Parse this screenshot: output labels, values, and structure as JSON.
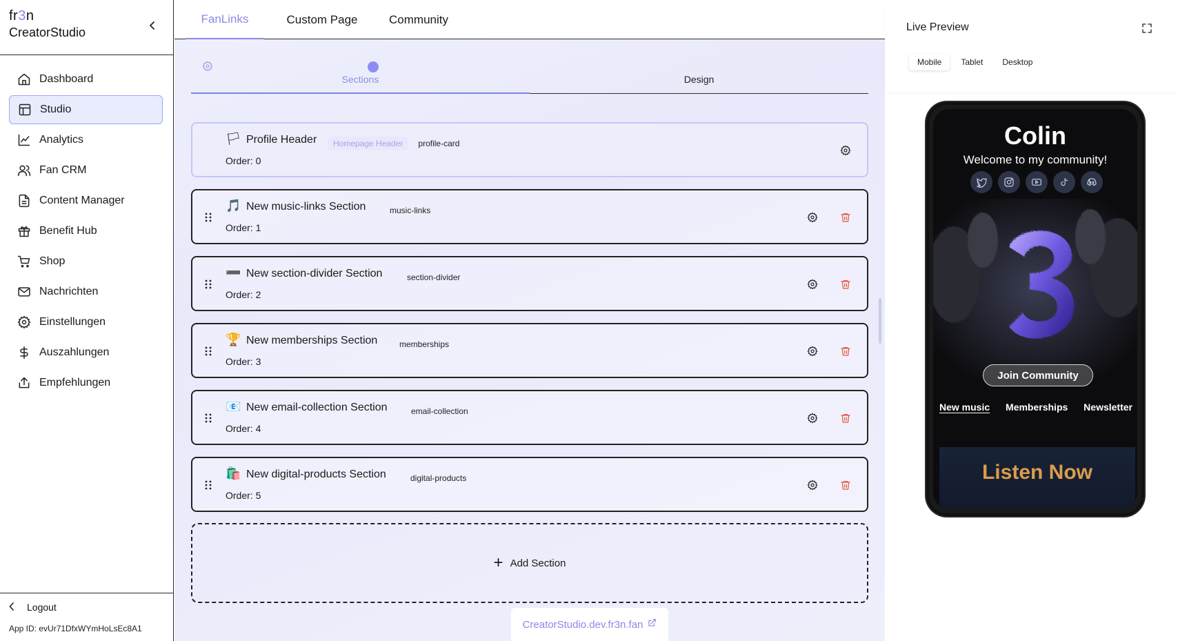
{
  "brand": {
    "line1_a": "fr",
    "line1_b": "3",
    "line1_c": "n",
    "line2": "CreatorStudio"
  },
  "sidebar": {
    "items": [
      {
        "label": "Dashboard",
        "icon": "home-icon"
      },
      {
        "label": "Studio",
        "icon": "layout-icon",
        "active": true
      },
      {
        "label": "Analytics",
        "icon": "line-chart-icon"
      },
      {
        "label": "Fan CRM",
        "icon": "users-icon"
      },
      {
        "label": "Content Manager",
        "icon": "file-text-icon"
      },
      {
        "label": "Benefit Hub",
        "icon": "gift-icon"
      },
      {
        "label": "Shop",
        "icon": "cart-icon"
      },
      {
        "label": "Nachrichten",
        "icon": "mail-icon"
      },
      {
        "label": "Einstellungen",
        "icon": "gear-icon"
      },
      {
        "label": "Auszahlungen",
        "icon": "dollar-icon"
      },
      {
        "label": "Empfehlungen",
        "icon": "share-icon"
      }
    ],
    "logout": "Logout",
    "app_id": "App ID: evUr71DfxWYmHoLsEc8A1"
  },
  "tabs": {
    "fanlinks": "FanLinks",
    "custom_page": "Custom Page",
    "community": "Community"
  },
  "steps": {
    "sections": "Sections",
    "design": "Design"
  },
  "sections": [
    {
      "icon": "🏳",
      "title": "Profile Header",
      "badge": "Homepage Header",
      "tag": "profile-card",
      "order": "Order: 0"
    },
    {
      "icon": "🎵",
      "title": "New music-links Section",
      "tag": "music-links",
      "order": "Order: 1"
    },
    {
      "icon": "➖",
      "title": "New section-divider Section",
      "tag": "section-divider",
      "order": "Order: 2"
    },
    {
      "icon": "🏆",
      "title": "New memberships Section",
      "tag": "memberships",
      "order": "Order: 3"
    },
    {
      "icon": "📧",
      "title": "New email-collection Section",
      "tag": "email-collection",
      "order": "Order: 4"
    },
    {
      "icon": "🛍️",
      "title": "New digital-products Section",
      "tag": "digital-products",
      "order": "Order: 5"
    }
  ],
  "add_section": "Add Section",
  "site_url": "CreatorStudio.dev.fr3n.fan",
  "preview": {
    "title": "Live Preview",
    "devices": [
      "Mobile",
      "Tablet",
      "Desktop"
    ],
    "name": "Colin",
    "welcome": "Welcome to my community!",
    "socials": [
      "twitter-icon",
      "instagram-icon",
      "youtube-icon",
      "tiktok-icon",
      "discord-icon"
    ],
    "join": "Join Community",
    "nav": [
      "New music",
      "Memberships",
      "Newsletter"
    ],
    "listen": "Listen Now"
  },
  "colors": {
    "accent": "#8d88e6",
    "active_bg": "#e8ecfd",
    "danger": "#e5533d",
    "listen_gold": "#d99d4c"
  }
}
